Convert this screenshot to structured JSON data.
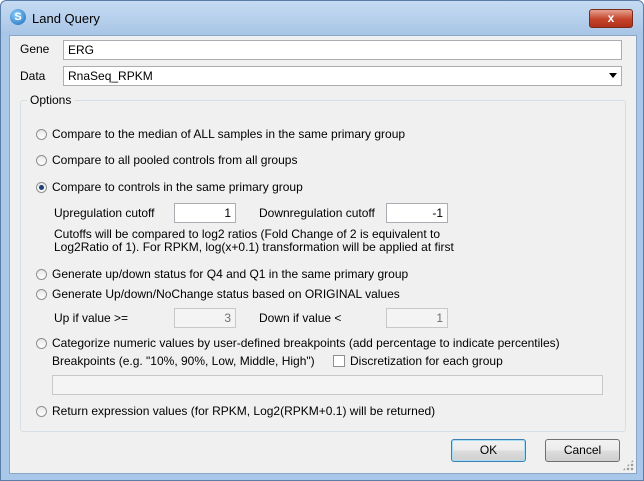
{
  "window": {
    "title": "Land Query",
    "close_label": "x"
  },
  "gene": {
    "label": "Gene",
    "value": "ERG"
  },
  "data": {
    "label": "Data",
    "selected": "RnaSeq_RPKM"
  },
  "options": {
    "legend": "Options",
    "median_label": "Compare to the median of ALL samples in the same primary group",
    "pooled_label": "Compare to all pooled controls from all groups",
    "controls_label": "Compare to controls in the same primary group",
    "up_cutoff_label": "Upregulation cutoff",
    "up_cutoff_value": "1",
    "down_cutoff_label": "Downregulation cutoff",
    "down_cutoff_value": "-1",
    "note_line1": "Cutoffs will be compared to log2 ratios (Fold Change of 2 is equivalent to",
    "note_line2": "Log2Ratio of 1). For RPKM, log(x+0.1) transformation will be applied at first",
    "q4q1_label": "Generate up/down status for Q4 and Q1 in the same primary group",
    "original_label": "Generate Up/down/NoChange status based on ORIGINAL values",
    "up_if_label": "Up if value >=",
    "up_if_value": "3",
    "down_if_label": "Down if value <",
    "down_if_value": "1",
    "categorize_label": "Categorize numeric values by user-defined breakpoints (add percentage to indicate percentiles)",
    "breakpoints_label": "Breakpoints (e.g. \"10%, 90%, Low, Middle, High\")",
    "discretization_label": "Discretization for each group",
    "breakpoints_value": "",
    "return_label": "Return expression values (for RPKM, Log2(RPKM+0.1) will be returned)"
  },
  "buttons": {
    "ok": "OK",
    "cancel": "Cancel"
  }
}
